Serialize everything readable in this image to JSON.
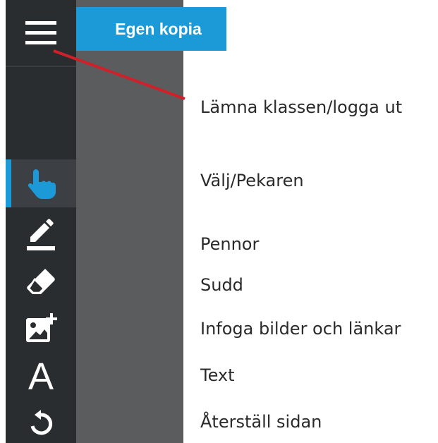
{
  "header": {
    "tab_label": "Egen kopia"
  },
  "toolbar": {
    "tools": [
      {
        "icon": "menu-icon"
      },
      {
        "icon": "hand-pointer-icon",
        "active": true
      },
      {
        "icon": "pen-icon"
      },
      {
        "icon": "eraser-icon"
      },
      {
        "icon": "insert-image-icon"
      },
      {
        "icon": "text-icon"
      },
      {
        "icon": "reset-icon"
      }
    ],
    "text_glyph": "A"
  },
  "legend": {
    "menu": "Lämna klassen/logga ut",
    "select": "Välj/Pekaren",
    "pens": "Pennor",
    "eraser": "Sudd",
    "insert": "Infoga bilder och länkar",
    "text": "Text",
    "reset": "Återställ sidan"
  },
  "colors": {
    "accent": "#1c9ad8",
    "toolbar": "#2a2d2f",
    "canvas": "#5a5c5e",
    "callout_line": "#d0202a"
  }
}
